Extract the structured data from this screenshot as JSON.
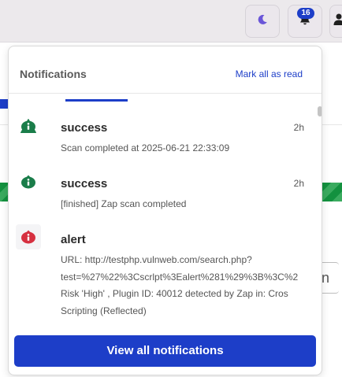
{
  "topbar": {
    "theme_icon": "moon-icon",
    "bell_icon": "bell-icon",
    "notification_count": "16",
    "user_icon": "user-icon"
  },
  "background": {
    "input_partial_text": "n"
  },
  "panel": {
    "title": "Notifications",
    "mark_all_label": "Mark all as read",
    "items": [
      {
        "type": "success",
        "icon": "info-icon",
        "color": "#1a7d4a",
        "title": "success",
        "time": "2h",
        "message": "Scan completed at 2025-06-21 22:33:09"
      },
      {
        "type": "success",
        "icon": "info-icon",
        "color": "#1a7d4a",
        "title": "success",
        "time": "2h",
        "message": "[finished] Zap scan completed"
      },
      {
        "type": "alert",
        "icon": "info-icon",
        "color": "#d63040",
        "title": "alert",
        "time": "",
        "message_lines": [
          "URL: http://testphp.vulnweb.com/search.php?",
          "test=%27%22%3Cscrlpt%3Ealert%281%29%3B%3C%2",
          "Risk 'High' , Plugin ID: 40012 detected by Zap in: Cros",
          "Scripting (Reflected)"
        ]
      }
    ],
    "view_all_label": "View all notifications"
  },
  "colors": {
    "accent": "#1d3ec8",
    "success": "#1a7d4a",
    "alert": "#d63040"
  }
}
